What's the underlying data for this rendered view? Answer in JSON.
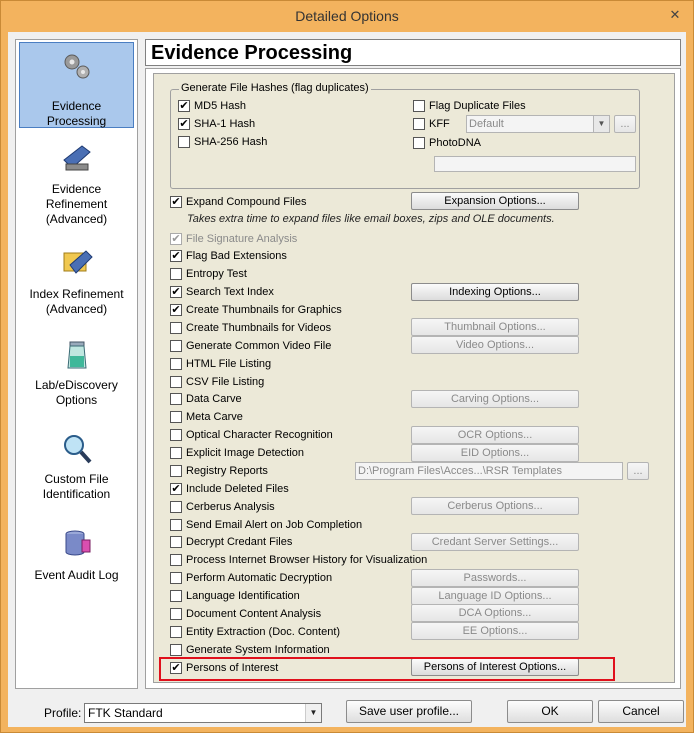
{
  "window": {
    "title": "Detailed Options",
    "close_glyph": "✕"
  },
  "nav": [
    {
      "id": "evidence-processing",
      "line1": "Evidence",
      "line2": "Processing",
      "line3": "",
      "icon": "gears-icon",
      "selected": true
    },
    {
      "id": "evidence-refinement",
      "line1": "Evidence",
      "line2": "Refinement",
      "line3": "(Advanced)",
      "icon": "scanner-icon",
      "selected": false
    },
    {
      "id": "index-refinement",
      "line1": "Index Refinement",
      "line2": "(Advanced)",
      "line3": "",
      "icon": "folder-scanner-icon",
      "selected": false
    },
    {
      "id": "lab-ediscovery",
      "line1": "Lab/eDiscovery",
      "line2": "Options",
      "line3": "",
      "icon": "beaker-icon",
      "selected": false
    },
    {
      "id": "custom-file-id",
      "line1": "Custom File",
      "line2": "Identification",
      "line3": "",
      "icon": "magnifier-icon",
      "selected": false
    },
    {
      "id": "event-audit-log",
      "line1": "Event Audit Log",
      "line2": "",
      "line3": "",
      "icon": "database-icon",
      "selected": false
    }
  ],
  "header": {
    "title": "Evidence Processing"
  },
  "hashes": {
    "group_title": "Generate File Hashes (flag duplicates)",
    "md5": {
      "label": "MD5 Hash",
      "checked": true
    },
    "sha1": {
      "label": "SHA-1 Hash",
      "checked": true
    },
    "sha256": {
      "label": "SHA-256 Hash",
      "checked": false
    },
    "flag_dup": {
      "label": "Flag Duplicate Files",
      "checked": false
    },
    "kff": {
      "label": "KFF",
      "checked": false,
      "select_value": "Default",
      "browse": "..."
    },
    "photodna": {
      "label": "PhotoDNA",
      "checked": false
    }
  },
  "options": {
    "expand": {
      "label": "Expand Compound Files",
      "checked": true,
      "note": "Takes extra time to expand files like email boxes, zips and OLE documents.",
      "button": "Expansion Options..."
    },
    "sig": {
      "label": "File Signature Analysis",
      "checked": true,
      "disabled": true
    },
    "bad_ext": {
      "label": "Flag Bad Extensions",
      "checked": true
    },
    "entropy": {
      "label": "Entropy Test",
      "checked": false
    },
    "search_index": {
      "label": "Search Text Index",
      "checked": true,
      "button": "Indexing Options..."
    },
    "thumb_gfx": {
      "label": "Create Thumbnails for Graphics",
      "checked": true
    },
    "thumb_vid": {
      "label": "Create Thumbnails for Videos",
      "checked": false,
      "button": "Thumbnail Options..."
    },
    "common_video": {
      "label": "Generate Common Video File",
      "checked": false,
      "button": "Video Options..."
    },
    "html_listing": {
      "label": "HTML File Listing",
      "checked": false
    },
    "csv_listing": {
      "label": "CSV File Listing",
      "checked": false
    },
    "data_carve": {
      "label": "Data Carve",
      "checked": false,
      "button": "Carving Options..."
    },
    "meta_carve": {
      "label": "Meta Carve",
      "checked": false
    },
    "ocr": {
      "label": "Optical Character Recognition",
      "checked": false,
      "button": "OCR Options..."
    },
    "eid": {
      "label": "Explicit Image Detection",
      "checked": false,
      "button": "EID Options..."
    },
    "registry": {
      "label": "Registry Reports",
      "checked": false,
      "path": "D:\\Program Files\\Acces...\\RSR Templates",
      "browse": "..."
    },
    "deleted": {
      "label": "Include Deleted Files",
      "checked": true
    },
    "cerberus": {
      "label": "Cerberus Analysis",
      "checked": false,
      "button": "Cerberus Options..."
    },
    "email_alert": {
      "label": "Send Email Alert on Job Completion",
      "checked": false
    },
    "credant": {
      "label": "Decrypt Credant Files",
      "checked": false,
      "button": "Credant Server Settings..."
    },
    "browser_history": {
      "label": "Process Internet Browser History for Visualization",
      "checked": false
    },
    "auto_decrypt": {
      "label": "Perform Automatic Decryption",
      "checked": false,
      "button": "Passwords..."
    },
    "lang_id": {
      "label": "Language Identification",
      "checked": false,
      "button": "Language ID Options..."
    },
    "dca": {
      "label": "Document Content Analysis",
      "checked": false,
      "button": "DCA Options..."
    },
    "entity": {
      "label": "Entity Extraction (Doc. Content)",
      "checked": false,
      "button": "EE Options..."
    },
    "sysinfo": {
      "label": "Generate System Information",
      "checked": false
    },
    "poi": {
      "label": "Persons of Interest",
      "checked": true,
      "button": "Persons of Interest Options..."
    }
  },
  "footer": {
    "profile_label": "Profile:",
    "profile_value": "FTK Standard",
    "save_label": "Save user profile...",
    "ok_label": "OK",
    "cancel_label": "Cancel"
  },
  "colors": {
    "title_bar": "#f3b35e",
    "nav_selected": "#aac8ec",
    "highlight_border": "#e0101c",
    "panel_bg": "#ece9d8"
  }
}
